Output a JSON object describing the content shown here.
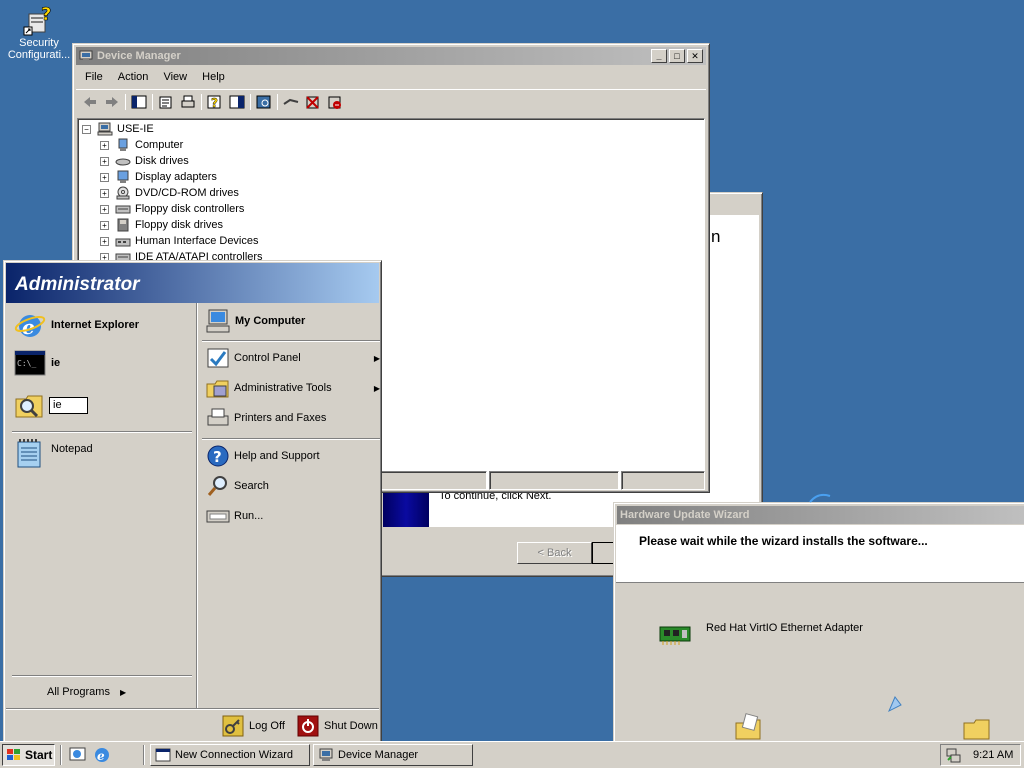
{
  "desktop": {
    "icon_label_line1": "Security",
    "icon_label_line2": "Configurati..."
  },
  "device_manager": {
    "title": "Device Manager",
    "menu": [
      "File",
      "Action",
      "View",
      "Help"
    ],
    "root": "USE-IE",
    "tree": [
      "Computer",
      "Disk drives",
      "Display adapters",
      "DVD/CD-ROM drives",
      "Floppy disk controllers",
      "Floppy disk drives",
      "Human Interface Devices",
      "IDE ATA/ATAPI controllers"
    ]
  },
  "new_connection_wizard": {
    "partial_heading": "n",
    "continue_text": "To continue, click Next.",
    "back_label": "< Back"
  },
  "hardware_wizard": {
    "title": "Hardware Update Wizard",
    "message": "Please wait while the wizard installs the software...",
    "device": "Red Hat VirtIO Ethernet Adapter"
  },
  "start_menu": {
    "user": "Administrator",
    "pinned": [
      "Internet Explorer",
      "ie"
    ],
    "run_value": "ie",
    "recent": [
      "Notepad"
    ],
    "all_programs": "All Programs",
    "right": {
      "my_computer": "My Computer",
      "control_panel": "Control Panel",
      "admin_tools": "Administrative Tools",
      "printers": "Printers and Faxes",
      "help": "Help and Support",
      "search": "Search",
      "run": "Run..."
    },
    "log_off": "Log Off",
    "shut_down": "Shut Down"
  },
  "taskbar": {
    "start": "Start",
    "buttons": [
      "New Connection Wizard",
      "Device Manager"
    ],
    "clock": "9:21 AM"
  }
}
